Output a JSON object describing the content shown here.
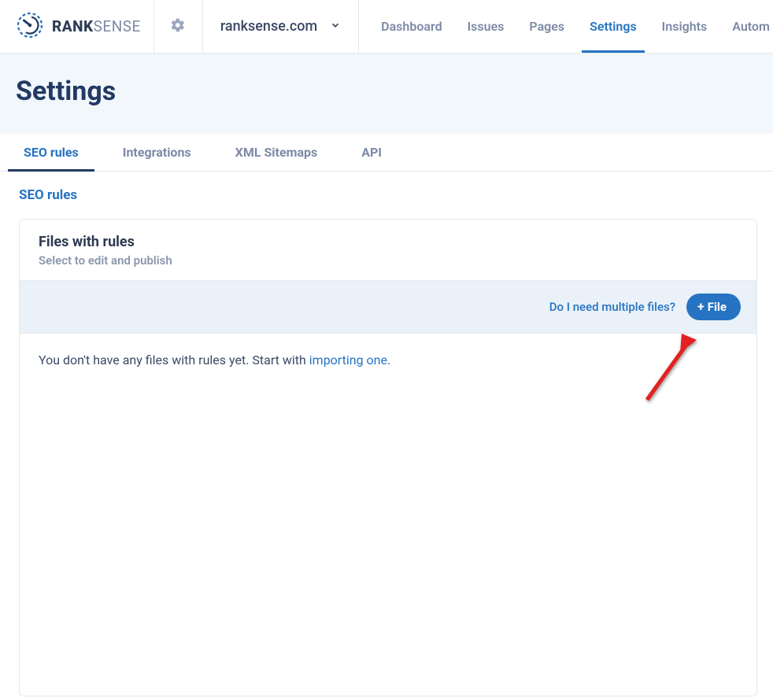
{
  "brand": {
    "bold": "RANK",
    "light": "SENSE"
  },
  "site_selector": {
    "current": "ranksense.com"
  },
  "nav": {
    "items": [
      {
        "label": "Dashboard",
        "active": false
      },
      {
        "label": "Issues",
        "active": false
      },
      {
        "label": "Pages",
        "active": false
      },
      {
        "label": "Settings",
        "active": true
      },
      {
        "label": "Insights",
        "active": false
      },
      {
        "label": "Autom",
        "active": false
      }
    ]
  },
  "page": {
    "title": "Settings"
  },
  "sub_tabs": [
    {
      "label": "SEO rules",
      "active": true
    },
    {
      "label": "Integrations",
      "active": false
    },
    {
      "label": "XML Sitemaps",
      "active": false
    },
    {
      "label": "API",
      "active": false
    }
  ],
  "section": {
    "heading": "SEO rules"
  },
  "card": {
    "title": "Files with rules",
    "subtitle": "Select to edit and publish",
    "help_link": "Do I need multiple files?",
    "add_button": "File",
    "empty_prefix": "You don't have any files with rules yet. Start with ",
    "empty_link": "importing one",
    "empty_suffix": "."
  }
}
